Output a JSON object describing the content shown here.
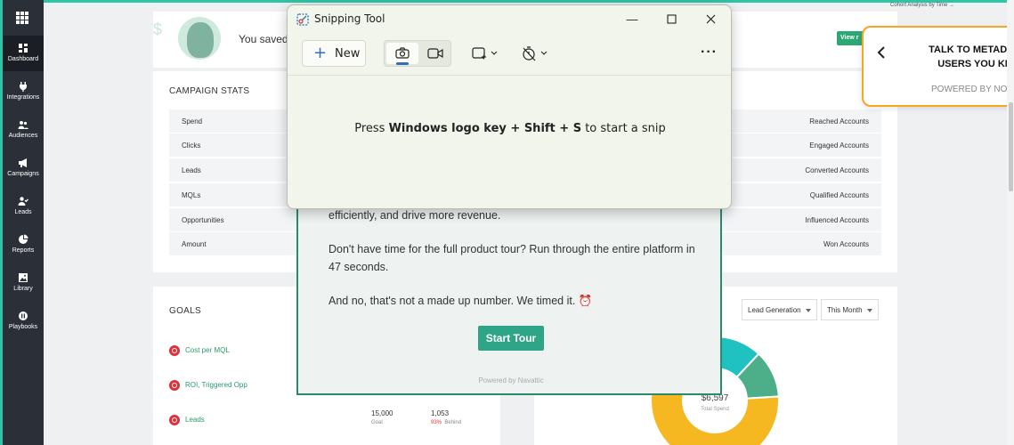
{
  "sidebar": {
    "items": [
      {
        "label": "Dashboard"
      },
      {
        "label": "Integrations"
      },
      {
        "label": "Audiences"
      },
      {
        "label": "Campaigns"
      },
      {
        "label": "Leads"
      },
      {
        "label": "Reports"
      },
      {
        "label": "Library"
      },
      {
        "label": "Playbooks"
      }
    ]
  },
  "header": {
    "cohort_link": "Cohort Analysis by Time",
    "banner_text": "You saved",
    "view_button": "View r"
  },
  "campaign_stats": {
    "title": "CAMPAIGN STATS",
    "rows": [
      {
        "left": "Spend",
        "right": "Reached Accounts"
      },
      {
        "left": "Clicks",
        "right": "Engaged Accounts"
      },
      {
        "left": "Leads",
        "right": "Converted Accounts"
      },
      {
        "left": "MQLs",
        "right": "Qualified Accounts"
      },
      {
        "left": "Opportunities",
        "right": "Influenced Accounts"
      },
      {
        "left": "Amount",
        "right": "Won Accounts"
      }
    ]
  },
  "goals": {
    "title": "GOALS",
    "items": [
      {
        "label": "Cost per MQL"
      },
      {
        "label": "ROI, Triggered Opp"
      },
      {
        "label": "Leads"
      }
    ],
    "leads_goal_value": "15,000",
    "leads_goal_label": "Goal",
    "leads_actual_value": "1,053",
    "leads_actual_pct": "93%",
    "leads_actual_status": "Behind"
  },
  "chart": {
    "filter_campaign": "Lead Generation",
    "filter_period": "This Month",
    "center_value": "$6,597",
    "center_label": "Total Spend"
  },
  "chart_data": {
    "type": "pie",
    "title": "",
    "slices": [
      {
        "value": 12,
        "color": "#1fc1c1"
      },
      {
        "value": 12,
        "color": "#4caf8a"
      },
      {
        "value": 76,
        "color": "#f5b820"
      }
    ],
    "center_value": "$6,597",
    "center_label": "Total Spend"
  },
  "tour": {
    "line1": "efficiently, and drive more revenue.",
    "line2": "Don't have time for the full product tour? Run through the entire platform in 47 seconds.",
    "line3": "And no, that's not a made up number. We timed it. ⏰",
    "start_button": "Start Tour",
    "powered_by": "Powered by Navattic"
  },
  "snipping_tool": {
    "title": "Snipping Tool",
    "new_button": "New",
    "message_prefix": "Press ",
    "message_bold": "Windows logo key + Shift + S",
    "message_suffix": " to start a snip"
  },
  "metadata_popup": {
    "title": "TALK TO METADATA USERS YOU KN",
    "title_line1": "TALK TO METADAT.",
    "title_line2": "USERS YOU KN",
    "subtitle": "POWERED BY NOB"
  },
  "colors": {
    "accent": "#2ec4a6",
    "sidebar_bg": "#2b2f38",
    "goal_text": "#2a9a6a",
    "alert_red": "#d9343a",
    "popup_border": "#f5a623"
  }
}
